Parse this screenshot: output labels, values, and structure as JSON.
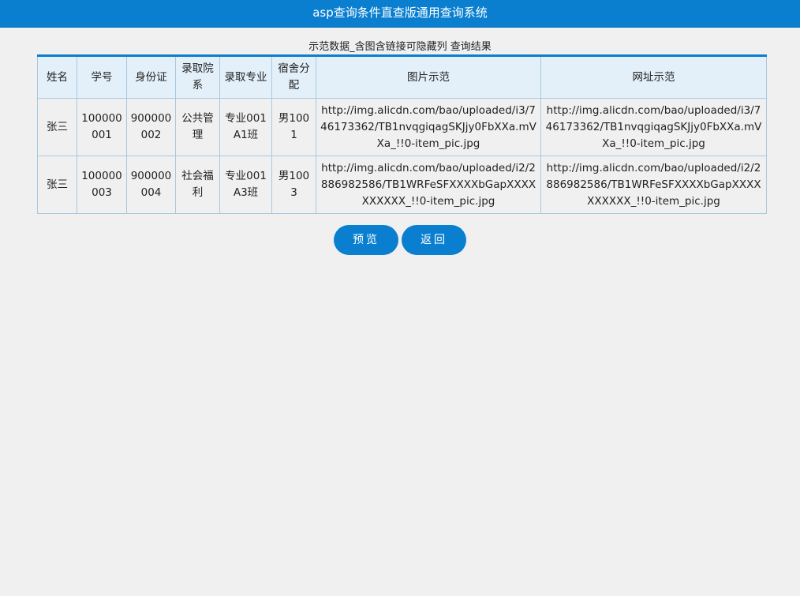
{
  "header": {
    "title": "asp查询条件直查版通用查询系统"
  },
  "caption": "示范数据_含图含链接可隐藏列 查询结果",
  "table": {
    "columns": [
      "姓名",
      "学号",
      "身份证",
      "录取院系",
      "录取专业",
      "宿舍分配",
      "图片示范",
      "网址示范"
    ],
    "rows": [
      {
        "name": "张三",
        "student_id": "100000001",
        "id_card": "900000002",
        "college": "公共管理",
        "major": "专业001A1班",
        "dorm": "男1001",
        "image_url": "http://img.alicdn.com/bao/uploaded/i3/746173362/TB1nvqgiqagSKJjy0FbXXa.mVXa_!!0-item_pic.jpg",
        "web_url": "http://img.alicdn.com/bao/uploaded/i3/746173362/TB1nvqgiqagSKJjy0FbXXa.mVXa_!!0-item_pic.jpg"
      },
      {
        "name": "张三",
        "student_id": "100000003",
        "id_card": "900000004",
        "college": "社会福利",
        "major": "专业001A3班",
        "dorm": "男1003",
        "image_url": "http://img.alicdn.com/bao/uploaded/i2/2886982586/TB1WRFeSFXXXXbGapXXXXXXXXXX_!!0-item_pic.jpg",
        "web_url": "http://img.alicdn.com/bao/uploaded/i2/2886982586/TB1WRFeSFXXXXbGapXXXXXXXXXX_!!0-item_pic.jpg"
      }
    ]
  },
  "buttons": {
    "preview": "预览",
    "back": "返回"
  },
  "colors": {
    "accent": "#0a7fd0",
    "header_bg": "#e3f0fa",
    "page_bg": "#f0f0f0",
    "border": "#a9c8dd"
  }
}
